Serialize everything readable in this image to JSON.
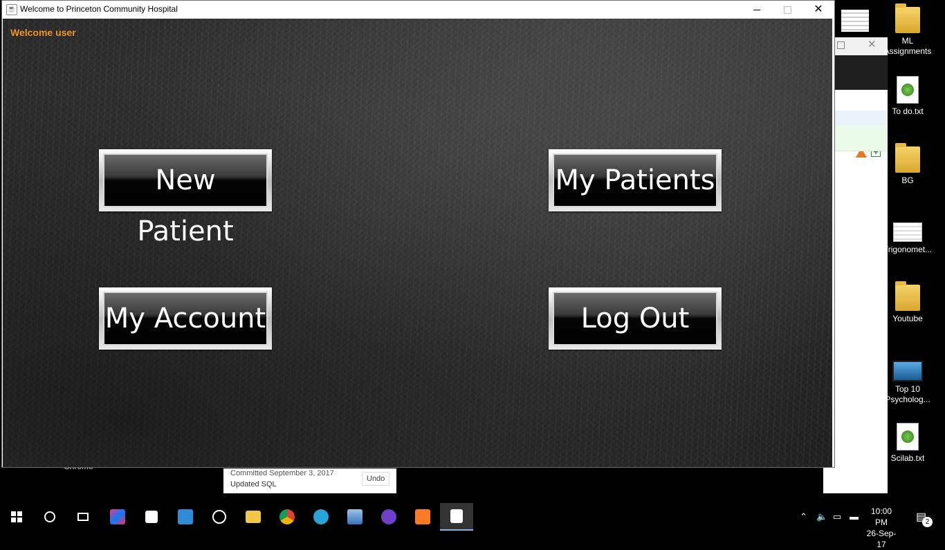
{
  "window": {
    "title": "Welcome to Princeton Community Hospital",
    "controls": {
      "minimize": "",
      "maximize": "",
      "close": "✕"
    }
  },
  "app": {
    "welcome_text": "Welcome user",
    "buttons": {
      "new_patient": "New Patient",
      "my_patients": "My Patients",
      "my_account": "My Account",
      "log_out": "Log Out"
    },
    "colors": {
      "welcome": "#f0941f",
      "button_face": "#000000",
      "button_bezel": "#d9d9d9"
    }
  },
  "background_window": {
    "commit_text": "Committed September 3, 2017",
    "commit_message": "Updated SQL",
    "undo_label": "Undo",
    "partial_label": "Chrome"
  },
  "desktop_icons": [
    {
      "label": "ML Assignments",
      "icon": "folder-icon"
    },
    {
      "label": "To do.txt",
      "icon": "text-file-icon"
    },
    {
      "label": "BG",
      "icon": "folder-icon"
    },
    {
      "label": "Trigonomet...",
      "icon": "image-file-icon"
    },
    {
      "label": "Youtube",
      "icon": "folder-icon"
    },
    {
      "label": "Top 10 Psycholog...",
      "icon": "video-file-icon"
    },
    {
      "label": "Scilab.txt",
      "icon": "text-file-icon"
    }
  ],
  "taskbar": {
    "time": "10:00 PM",
    "date": "26-Sep-17",
    "notification_count": "2",
    "apps": [
      "start",
      "cortana",
      "task-view",
      "intellij",
      "store",
      "app-installer",
      "iheartradio",
      "file-explorer",
      "chrome",
      "browser",
      "virtualbox",
      "github",
      "xampp",
      "java"
    ]
  }
}
